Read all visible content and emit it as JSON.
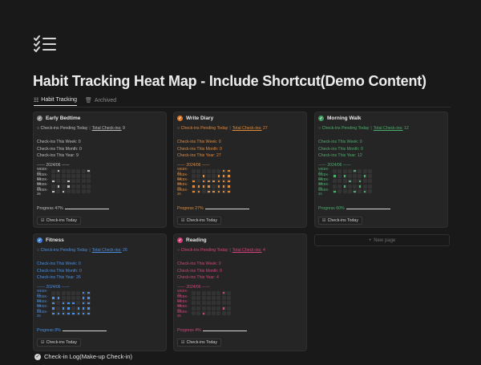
{
  "page": {
    "icon": "checklist-icon",
    "title": "Habit Tracking Heat Map - Include Shortcut(Demo Content)"
  },
  "tabs": [
    {
      "label": "Habit Tracking",
      "icon": "table-icon",
      "active": true
    },
    {
      "label": "Archived",
      "icon": "trash-icon",
      "active": false
    }
  ],
  "cards": [
    {
      "title": "Early Bedtime",
      "color": "#bfbfbf",
      "check_bg": "#8f8f8f",
      "status_text": "○ Check-ins Pending Today",
      "total_label": "Total Check-ins:",
      "total_value": "9",
      "week_label": "Check-ins This Week:",
      "week_value": "0",
      "month_label": "Check-ins This Month:",
      "month_value": "0",
      "year_label": "Check-ins This Year:",
      "year_value": "9",
      "month_line": "------ 2024/06 ------",
      "weeks": [
        {
          "label": "WEEK-22",
          "cells": [
            0,
            0,
            0,
            0,
            0,
            0,
            0,
            0,
            0,
            0,
            0,
            0
          ]
        },
        {
          "label": "WEEK-23",
          "cells": [
            0,
            0,
            0,
            0,
            0,
            0,
            0,
            0,
            0,
            0,
            0,
            0
          ]
        },
        {
          "label": "WEEK-24",
          "cells": [
            0,
            0,
            0,
            0,
            0,
            0,
            0,
            0,
            0,
            0,
            0,
            0
          ]
        },
        {
          "label": "WEEK-25",
          "cells": [
            0,
            0,
            0,
            0,
            0,
            0,
            0,
            0,
            0,
            0,
            0,
            0
          ]
        },
        {
          "label": "WEEK-26",
          "cells": [
            0,
            0,
            0,
            0,
            0,
            0,
            0,
            0,
            0,
            0,
            0,
            0
          ]
        }
      ],
      "filled": [
        [
          0,
          1,
          0,
          0,
          0,
          0,
          0,
          1
        ],
        [
          0,
          0,
          0,
          0,
          0,
          0,
          0,
          0
        ],
        [
          1,
          0,
          0,
          1,
          0,
          0,
          0,
          0
        ],
        [
          0,
          1,
          0,
          1,
          0,
          0,
          0,
          0
        ],
        [
          1,
          0,
          1,
          0,
          0,
          0,
          0,
          0
        ]
      ],
      "progress_label": "Progress 47%",
      "progress": 47,
      "button_label": "Check-ins Today"
    },
    {
      "title": "Write Diary",
      "color": "#e08a3c",
      "check_bg": "#d9772b",
      "status_text": "○ Check-ins Pending Today",
      "total_label": "Total Check-ins:",
      "total_value": "27",
      "week_label": "Check-ins This Week:",
      "week_value": "0",
      "month_label": "Check-ins This Month:",
      "month_value": "0",
      "year_label": "Check-ins This Year:",
      "year_value": "27",
      "month_line": "------ 2024/06 ------",
      "weeks": [
        {
          "label": "WEEK-22"
        },
        {
          "label": "WEEK-23"
        },
        {
          "label": "WEEK-24"
        },
        {
          "label": "WEEK-25"
        },
        {
          "label": "WEEK-26"
        }
      ],
      "filled": [
        [
          0,
          0,
          0,
          0,
          0,
          0,
          1,
          1
        ],
        [
          0,
          0,
          1,
          0,
          0,
          1,
          1,
          1
        ],
        [
          1,
          0,
          1,
          1,
          1,
          1,
          1,
          1
        ],
        [
          1,
          1,
          1,
          1,
          0,
          1,
          1,
          1
        ],
        [
          1,
          1,
          0,
          1,
          1,
          1,
          1,
          1
        ]
      ],
      "progress_label": "Progress 27%",
      "progress": 27,
      "button_label": "Check-ins Today"
    },
    {
      "title": "Morning Walk",
      "color": "#4cae6e",
      "check_bg": "#3f9a5e",
      "status_text": "○ Check-ins Pending Today",
      "total_label": "Total Check-ins:",
      "total_value": "12",
      "week_label": "Check-ins This Week:",
      "week_value": "0",
      "month_label": "Check-ins This Month:",
      "month_value": "0",
      "year_label": "Check-ins This Year:",
      "year_value": "12",
      "month_line": "------ 2024/06 ------",
      "weeks": [
        {
          "label": "WEEK-22"
        },
        {
          "label": "WEEK-23"
        },
        {
          "label": "WEEK-24"
        },
        {
          "label": "WEEK-25"
        },
        {
          "label": "WEEK-26"
        }
      ],
      "filled": [
        [
          0,
          0,
          0,
          0,
          1,
          0,
          0,
          0
        ],
        [
          1,
          0,
          1,
          0,
          0,
          0,
          1,
          0
        ],
        [
          0,
          0,
          0,
          1,
          0,
          1,
          0,
          0
        ],
        [
          0,
          0,
          1,
          0,
          0,
          1,
          0,
          0
        ],
        [
          1,
          0,
          0,
          0,
          1,
          0,
          1,
          0
        ]
      ],
      "progress_label": "Progress 60%",
      "progress": 60,
      "button_label": "Check-ins Today"
    },
    {
      "title": "Fitness",
      "color": "#4a8fe0",
      "check_bg": "#3f7fd0",
      "status_text": "○ Check-ins Pending Today",
      "total_label": "Total Check-ins:",
      "total_value": "26",
      "week_label": "Check-ins This Week:",
      "week_value": "0",
      "month_label": "Check-ins This Month:",
      "month_value": "0",
      "year_label": "Check-ins This Year:",
      "year_value": "26",
      "month_line": "------ 2024/06 ------",
      "weeks": [
        {
          "label": "WEEK-22"
        },
        {
          "label": "WEEK-23"
        },
        {
          "label": "WEEK-24"
        },
        {
          "label": "WEEK-25"
        },
        {
          "label": "WEEK-26"
        }
      ],
      "filled": [
        [
          0,
          0,
          0,
          0,
          0,
          0,
          1,
          1
        ],
        [
          1,
          1,
          0,
          0,
          0,
          0,
          1,
          1
        ],
        [
          1,
          0,
          1,
          1,
          1,
          0,
          1,
          1
        ],
        [
          1,
          0,
          1,
          1,
          0,
          1,
          1,
          1
        ],
        [
          1,
          1,
          1,
          1,
          1,
          1,
          1,
          1
        ]
      ],
      "progress_label": "Progress 8%",
      "progress": 8,
      "button_label": "Check-ins Today"
    },
    {
      "title": "Reading",
      "color": "#d6447d",
      "check_bg": "#cc3f74",
      "status_text": "○ Check-ins Pending Today",
      "total_label": "Total Check-ins:",
      "total_value": "4",
      "week_label": "Check-ins This Week:",
      "week_value": "0",
      "month_label": "Check-ins This Month:",
      "month_value": "0",
      "year_label": "Check-ins This Year:",
      "year_value": "4",
      "month_line": "------ 2024/06 ------",
      "weeks": [
        {
          "label": "WEEK-22"
        },
        {
          "label": "WEEK-23"
        },
        {
          "label": "WEEK-24"
        },
        {
          "label": "WEEK-25"
        },
        {
          "label": "WEEK-26"
        }
      ],
      "filled": [
        [
          0,
          0,
          0,
          0,
          0,
          0,
          1,
          0
        ],
        [
          0,
          0,
          0,
          0,
          0,
          0,
          0,
          0
        ],
        [
          0,
          0,
          0,
          0,
          0,
          0,
          0,
          0
        ],
        [
          0,
          0,
          0,
          0,
          0,
          0,
          1,
          0
        ],
        [
          0,
          0,
          1,
          0,
          0,
          0,
          0,
          0
        ]
      ],
      "progress_label": "Progress 4%",
      "progress": 4,
      "button_label": "Check-ins Today"
    }
  ],
  "new_page_label": "New page",
  "log": {
    "title": "Check-in Log(Make-up Check-in)"
  }
}
